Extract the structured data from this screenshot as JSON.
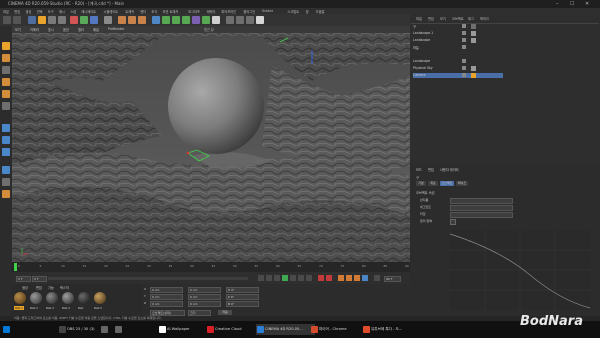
{
  "window": {
    "title": "CINEMA 4D R20.059 Studio (RC - R20) - [계곡.c4d *] - Main",
    "controls": [
      "–",
      "☐",
      "✕"
    ]
  },
  "menu": [
    "파일",
    "편집",
    "생성",
    "선택",
    "도구",
    "메시",
    "스냅",
    "애니메이트",
    "시뮬레이트",
    "트래커",
    "렌더",
    "조각",
    "모션 트래커",
    "모그라프",
    "캐릭터",
    "파이프라인",
    "플러그인",
    "Octane",
    "스크립트",
    "창",
    "도움말"
  ],
  "viewport": {
    "menu": [
      "보기",
      "카메라",
      "표시",
      "옵션",
      "필터",
      "패널",
      "ProRender"
    ],
    "label": "원근 뷰"
  },
  "objects": {
    "tabs": [
      "파일",
      "편집",
      "보기",
      "오브젝트",
      "태그",
      "북마크"
    ],
    "items": [
      "구",
      "Landscape.1",
      "Landscape",
      "하늘",
      "Landscape",
      "Physical Sky",
      "Camera"
    ]
  },
  "attributes": {
    "tabs": [
      "모드",
      "편집",
      "사용자 데이터"
    ],
    "subtabs": [
      "기본",
      "좌표",
      "오브젝트",
      "페이즈"
    ],
    "section": "오브젝트 속성",
    "rows": [
      "반지름",
      "세그먼트",
      "타입",
      "렌더 완벽"
    ]
  },
  "timeline": {
    "ticks": [
      "0",
      "5",
      "10",
      "15",
      "20",
      "25",
      "30",
      "35",
      "40",
      "45",
      "50",
      "55",
      "60",
      "65",
      "70",
      "75",
      "80",
      "85",
      "90"
    ],
    "frame_start": "0 F",
    "frame_end": "90 F"
  },
  "materials": {
    "menu": [
      "생성",
      "편집",
      "기능",
      "텍스처"
    ],
    "names": [
      "Mat.1",
      "Mat.2",
      "Mat.3",
      "Mat.4",
      "Mat",
      "Mat.5"
    ]
  },
  "coordinates": {
    "rows": [
      {
        "axis": "X",
        "pos": "0 cm",
        "size": "0 cm",
        "rot": "H 0°"
      },
      {
        "axis": "Y",
        "pos": "0 cm",
        "size": "0 cm",
        "rot": "P 0°"
      },
      {
        "axis": "Z",
        "pos": "0 cm",
        "size": "0 cm",
        "rot": "B 0°"
      }
    ],
    "apply": "적용",
    "mode": "오브젝트(상대)",
    "size_mode": "크기"
  },
  "status": "이동: 클릭 드래그하여 요소를 이동. SHIFT 키를 누르면 이동 값을 스냅합니다. CTRL 키를 누르면 요소를 복제합니다.",
  "taskbar": {
    "items": [
      {
        "label": "",
        "color": "#0078d7"
      },
      {
        "label": "OBS 25 / 30 (3)",
        "color": "#444"
      },
      {
        "label": "",
        "color": "#666"
      },
      {
        "label": "",
        "color": "#666"
      },
      {
        "label": "AI Wallpaper",
        "color": "#ffffff"
      },
      {
        "label": "Creative Cloud",
        "color": "#da1f26"
      },
      {
        "label": "CINEMA 4D R20.05...",
        "color": "#2a7fd4"
      },
      {
        "label": "파이어 - Chrome",
        "color": "#d64b2c"
      },
      {
        "label": "유튜브에 톡다 - 도...",
        "color": "#e04b2c"
      }
    ]
  },
  "watermark": "BodNara",
  "colors": {
    "accent": "#e9a52b",
    "selection": "#4a6ea8"
  }
}
